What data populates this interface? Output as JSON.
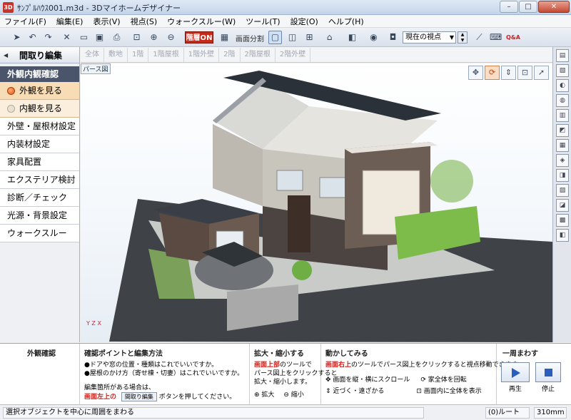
{
  "window": {
    "title": "ｻﾝﾌﾟﾙﾊｳｽ001.m3d - 3Dマイホームデザイナー",
    "app_badge": "3D"
  },
  "menu": [
    "ファイル(F)",
    "編集(E)",
    "表示(V)",
    "視点(S)",
    "ウォークスルー(W)",
    "ツール(T)",
    "設定(O)",
    "ヘルプ(H)"
  ],
  "toolbar": {
    "floor_on_label": "階層ON",
    "split_label": "画面分割",
    "viewpoint_value": "現在の視点",
    "qa_label": "Q&A"
  },
  "left_panel": {
    "title": "間取り編集",
    "section": "外観内観確認",
    "view_options": [
      {
        "label": "外観を見る",
        "selected": true
      },
      {
        "label": "内観を見る",
        "selected": false
      }
    ],
    "items": [
      "外壁・屋根材設定",
      "内装材設定",
      "家具配置",
      "エクステリア検討",
      "診断／チェック",
      "光源・背景設定",
      "ウォークスルー"
    ]
  },
  "floor_tabs": [
    "全体",
    "敷地",
    "1階",
    "1階屋根",
    "1階外壁",
    "2階",
    "2階屋根",
    "2階外壁"
  ],
  "viewport": {
    "label": "パース図",
    "axis_label": "Y Z X"
  },
  "help": {
    "sec1_title": "外観確認",
    "sec2_title": "確認ポイントと編集方法",
    "sec2_lines": [
      "●ドアや窓の位置・種類はこれでいいですか。",
      "●屋根のかけ方（寄せ棟・切妻）はこれでいいですか。"
    ],
    "sec2_edit_line": "編集箇所がある場合は、",
    "sec2_edit_red": "画面左上の",
    "sec2_edit_button": "間取り編集",
    "sec2_edit_tail": "ボタンを押してください。",
    "sec3_title": "拡大・縮小する",
    "sec3_red": "画面上部",
    "sec3_l1_tail": "のツールで",
    "sec3_l2": "パース図上をクリックすると",
    "sec3_l3": "拡大・縮小します。",
    "zoom_in": "拡大",
    "zoom_out": "縮小",
    "sec4_title": "動かしてみる",
    "sec4_red": "画面右上",
    "sec4_l1_tail": "のツールでパース図上をクリックすると視点移動できます。",
    "sec4_ops": [
      "画面を縦・横にスクロール",
      "家全体を回転",
      "近づく・遠ざかる",
      "画面内に全体を表示"
    ],
    "sec5_title": "一周まわす",
    "play_label": "再生",
    "stop_label": "停止"
  },
  "status": {
    "left": "選択オブジェクトを中心に周囲をまわる",
    "route": "(0)ルート",
    "size": "310mm"
  }
}
